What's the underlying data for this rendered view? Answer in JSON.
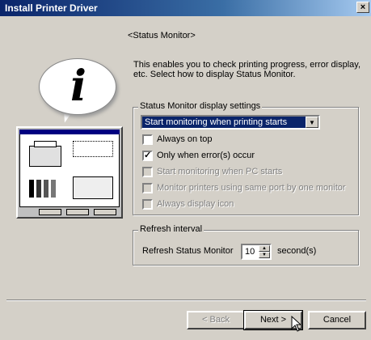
{
  "window": {
    "title": "Install Printer Driver",
    "close_glyph": "×"
  },
  "heading": "<Status Monitor>",
  "description": "This enables you to check printing progress, error display, etc. Select how to display Status Monitor.",
  "display_settings": {
    "group_title": "Status Monitor display settings",
    "select_value": "Start monitoring when printing starts",
    "checkboxes": [
      {
        "label": "Always on top",
        "checked": false,
        "enabled": true
      },
      {
        "label": "Only when error(s) occur",
        "checked": true,
        "enabled": true
      },
      {
        "label": "Start monitoring when PC starts",
        "checked": false,
        "enabled": false
      },
      {
        "label": "Monitor printers using same port by one monitor",
        "checked": false,
        "enabled": false
      },
      {
        "label": "Always display icon",
        "checked": false,
        "enabled": false
      }
    ]
  },
  "refresh": {
    "group_title": "Refresh interval",
    "label": "Refresh Status Monitor",
    "value": "10",
    "unit": "second(s)"
  },
  "buttons": {
    "back": "< Back",
    "next": "Next >",
    "cancel": "Cancel"
  },
  "icons": {
    "info": "info-bubble-icon",
    "monitor": "status-monitor-illustration",
    "cursor": "mouse-pointer-icon"
  }
}
